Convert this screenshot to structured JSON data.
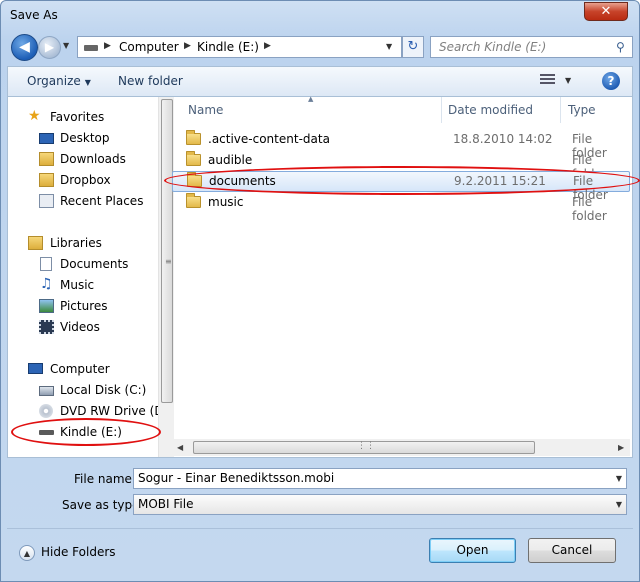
{
  "window": {
    "title": "Save As",
    "close_label": "✕"
  },
  "nav": {
    "back_icon": "back-arrow-icon",
    "forward_icon": "forward-arrow-icon",
    "breadcrumbs": [
      "Computer",
      "Kindle (E:)"
    ],
    "search_placeholder": "Search Kindle (E:)"
  },
  "toolbar": {
    "organize_label": "Organize",
    "new_folder_label": "New folder",
    "help_label": "?"
  },
  "sidebar": {
    "favorites_header": "Favorites",
    "favorites": [
      "Desktop",
      "Downloads",
      "Dropbox",
      "Recent Places"
    ],
    "libraries_header": "Libraries",
    "libraries": [
      "Documents",
      "Music",
      "Pictures",
      "Videos"
    ],
    "computer_header": "Computer",
    "drives": [
      "Local Disk (C:)",
      "DVD RW Drive (D",
      "Kindle (E:)"
    ]
  },
  "filelist": {
    "columns": {
      "name": "Name",
      "date": "Date modified",
      "type": "Type"
    },
    "rows": [
      {
        "name": ".active-content-data",
        "date": "18.8.2010 14:02",
        "type": "File folder"
      },
      {
        "name": "audible",
        "date": "",
        "type": "File folder"
      },
      {
        "name": "documents",
        "date": "9.2.2011 15:21",
        "type": "File folder"
      },
      {
        "name": "music",
        "date": "",
        "type": "File folder"
      }
    ],
    "selected_row": "documents"
  },
  "form": {
    "file_name_label": "File name:",
    "file_name_value": "Sogur - Einar Benediktsson.mobi",
    "save_type_label": "Save as type:",
    "save_type_value": "MOBI File"
  },
  "footer": {
    "hide_folders_label": "Hide Folders",
    "open_label": "Open",
    "cancel_label": "Cancel"
  },
  "colors": {
    "highlight_ellipse": "#e01010",
    "selection": "#d6e6f9"
  }
}
